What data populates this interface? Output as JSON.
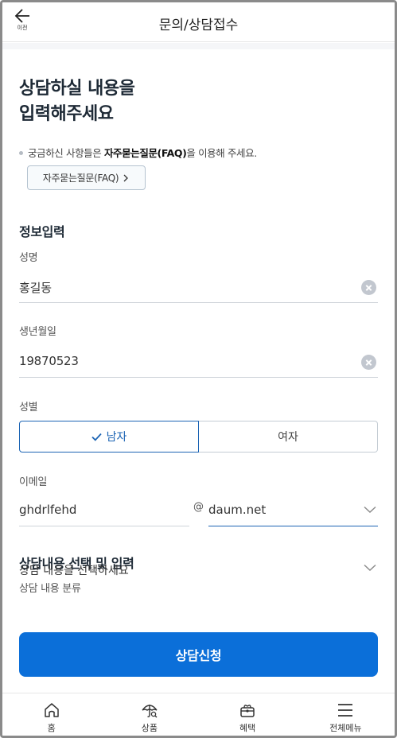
{
  "header": {
    "back_label": "이전",
    "title": "문의/상담접수"
  },
  "intro": {
    "heading_line1": "상담하실 내용을",
    "heading_line2": "입력해주세요",
    "faq_note_prefix": "궁금하신 사항들은 ",
    "faq_note_bold": "자주묻는질문(FAQ)",
    "faq_note_suffix": "을 이용해 주세요.",
    "faq_button_label": "자주묻는질문(FAQ)",
    "faq_button_chevron": "›"
  },
  "info": {
    "section_title": "정보입력",
    "name_label": "성명",
    "name_value": "홍길동",
    "birth_label": "생년월일",
    "birth_value": "19870523",
    "gender_label": "성별",
    "gender_male": "남자",
    "gender_female": "여자",
    "gender_selected": "male",
    "email_label": "이메일",
    "email_user": "ghdrlfehd",
    "email_at": "@",
    "email_domain": "daum.net"
  },
  "consult": {
    "section_title": "상담내용 선택 및 입력",
    "category_label": "상담 내용 분류",
    "category_placeholder": "상담 내용을 선택하세요"
  },
  "submit_label": "상담신청",
  "bottom_nav": [
    {
      "label": "홈",
      "icon": "home-icon"
    },
    {
      "label": "상품",
      "icon": "umbrella-search-icon"
    },
    {
      "label": "혜택",
      "icon": "gift-icon"
    },
    {
      "label": "전체메뉴",
      "icon": "menu-icon"
    }
  ],
  "colors": {
    "accent": "#0b6fd9",
    "selected_border": "#1c64b4",
    "heading": "#1e2a36"
  }
}
